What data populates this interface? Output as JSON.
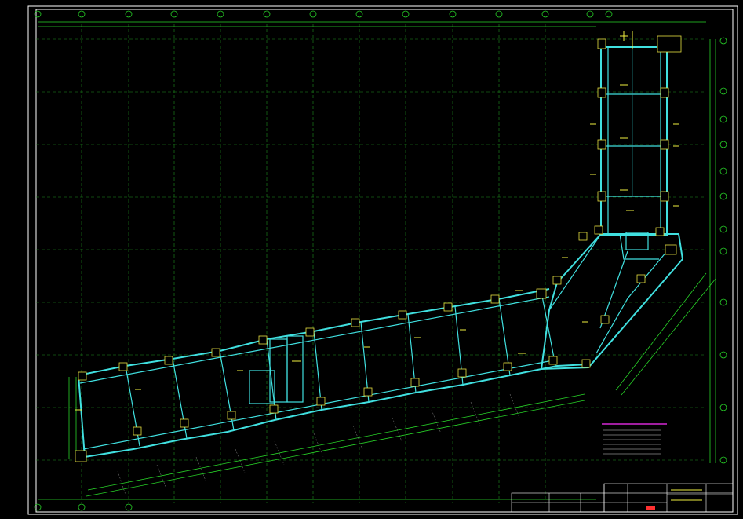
{
  "colors": {
    "background": "#000000",
    "frame": "#ffffff",
    "grid": "#1e8f1e",
    "dimension": "#28d428",
    "beam": "#40e0e0",
    "column": "#e8e040",
    "notes_accent": "#ff30ff",
    "stamp": "#ff3030"
  },
  "icons": [
    "axis-bubble-icon",
    "column-marker-icon"
  ]
}
